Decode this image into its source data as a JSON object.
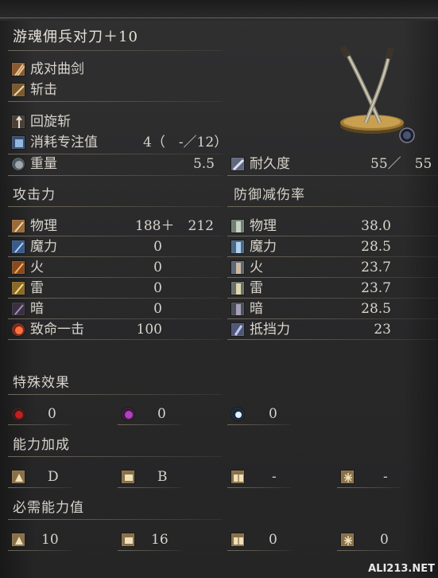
{
  "title": "游魂佣兵对刀＋10",
  "weapon_type": "成对曲剑",
  "attack_type": "斩击",
  "skill": "回旋斩",
  "fp_cost": {
    "label": "消耗专注值",
    "value": "4（　-／12）"
  },
  "weight": {
    "label": "重量",
    "value": "5.5"
  },
  "durability": {
    "label": "耐久度",
    "value": "55／　55"
  },
  "attack": {
    "heading": "攻击力",
    "rows": [
      {
        "label": "物理",
        "value": "188＋　212",
        "icon": "physical-attack-icon"
      },
      {
        "label": "魔力",
        "value": "0",
        "icon": "magic-attack-icon"
      },
      {
        "label": "火",
        "value": "0",
        "icon": "fire-attack-icon"
      },
      {
        "label": "雷",
        "value": "0",
        "icon": "lightning-attack-icon"
      },
      {
        "label": "暗",
        "value": "0",
        "icon": "dark-attack-icon"
      },
      {
        "label": "致命一击",
        "value": "100",
        "icon": "critical-icon"
      }
    ]
  },
  "defense": {
    "heading": "防御减伤率",
    "rows": [
      {
        "label": "物理",
        "value": "38.0",
        "icon": "physical-defense-icon"
      },
      {
        "label": "魔力",
        "value": "28.5",
        "icon": "magic-defense-icon"
      },
      {
        "label": "火",
        "value": "23.7",
        "icon": "fire-defense-icon"
      },
      {
        "label": "雷",
        "value": "23.7",
        "icon": "lightning-defense-icon"
      },
      {
        "label": "暗",
        "value": "28.5",
        "icon": "dark-defense-icon"
      },
      {
        "label": "抵挡力",
        "value": "23",
        "icon": "stability-icon"
      }
    ]
  },
  "effects": {
    "heading": "特殊效果",
    "items": [
      {
        "value": "0",
        "icon": "bleed-icon"
      },
      {
        "value": "0",
        "icon": "poison-icon"
      },
      {
        "value": "0",
        "icon": "frost-icon"
      }
    ]
  },
  "scaling": {
    "heading": "能力加成",
    "items": [
      {
        "value": "D",
        "icon": "strength-icon"
      },
      {
        "value": "B",
        "icon": "dexterity-icon"
      },
      {
        "value": "-",
        "icon": "intelligence-icon"
      },
      {
        "value": "-",
        "icon": "faith-icon"
      }
    ]
  },
  "requirements": {
    "heading": "必需能力值",
    "items": [
      {
        "value": "10",
        "icon": "strength-icon"
      },
      {
        "value": "16",
        "icon": "dexterity-icon"
      },
      {
        "value": "0",
        "icon": "intelligence-icon"
      },
      {
        "value": "0",
        "icon": "faith-icon"
      }
    ]
  },
  "watermark": "ALI213.NET"
}
